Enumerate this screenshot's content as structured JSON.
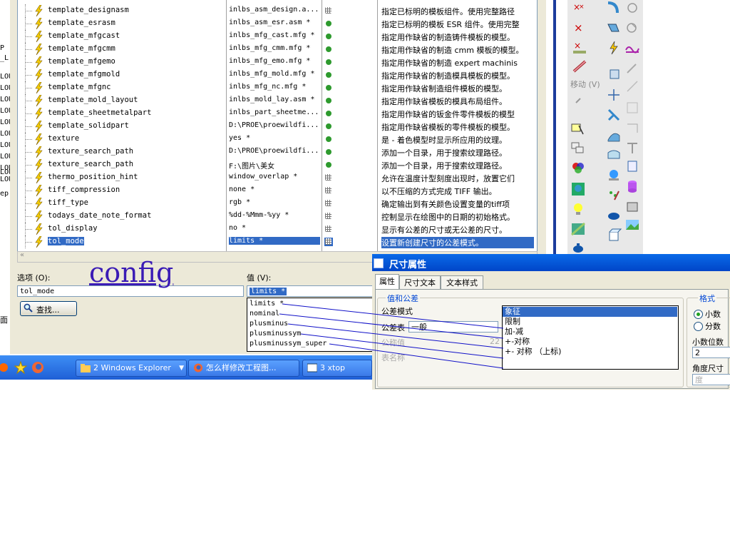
{
  "left_strip": [
    "P",
    "_L",
    "LOU",
    "LOU",
    "LOU",
    "LOU",
    "LOU",
    "LOU",
    "LOU",
    "LOU",
    "LOU",
    "LOU",
    "LOU",
    "ep"
  ],
  "config": {
    "rows": [
      {
        "name": "template_designasm",
        "value": "inlbs_asm_design.a...",
        "status": "grid",
        "desc": "指定已标明的模板组件。使用完整路径"
      },
      {
        "name": "template_esrasm",
        "value": "inlbs_asm_esr.asm *",
        "status": "green",
        "desc": "指定已标明的模板 ESR 组件。使用完整"
      },
      {
        "name": "template_mfgcast",
        "value": "inlbs_mfg_cast.mfg *",
        "status": "green",
        "desc": "指定用作缺省的制造铸件模板的模型。"
      },
      {
        "name": "template_mfgcmm",
        "value": "inlbs_mfg_cmm.mfg *",
        "status": "green",
        "desc": "指定用作缺省的制造 cmm 模板的模型。"
      },
      {
        "name": "template_mfgemo",
        "value": "inlbs_mfg_emo.mfg *",
        "status": "green",
        "desc": "指定用作缺省的制造 expert machinis"
      },
      {
        "name": "template_mfgmold",
        "value": "inlbs_mfg_mold.mfg *",
        "status": "green",
        "desc": "指定用作缺省的制造模具模板的模型。"
      },
      {
        "name": "template_mfgnc",
        "value": "inlbs_mfg_nc.mfg *",
        "status": "green",
        "desc": "指定用作缺省制造组件模板的模型。"
      },
      {
        "name": "template_mold_layout",
        "value": "inlbs_mold_lay.asm *",
        "status": "green",
        "desc": "指定用作缺省模板的模具布局组件。"
      },
      {
        "name": "template_sheetmetalpart",
        "value": "inlbs_part_sheetme...",
        "status": "green",
        "desc": "指定用作缺省的钣金件零件模板的模型"
      },
      {
        "name": "template_solidpart",
        "value": "D:\\PROE\\proewildfi...",
        "status": "green",
        "desc": "指定用作缺省模板的零件模板的模型。"
      },
      {
        "name": "texture",
        "value": "yes *",
        "status": "green",
        "desc": "是 - 着色模型时显示所应用的纹理。"
      },
      {
        "name": "texture_search_path",
        "value": "D:\\PROE\\proewildfi...",
        "status": "green",
        "desc": "添加一个目录，用于搜索纹理路径。"
      },
      {
        "name": "texture_search_path",
        "value": "F:\\图片\\美女",
        "status": "green",
        "desc": "添加一个目录，用于搜索纹理路径。"
      },
      {
        "name": "thermo_position_hint",
        "value": "window_overlap *",
        "status": "grid",
        "desc": "允许在温度计型刻度出现时，放置它们"
      },
      {
        "name": "tiff_compression",
        "value": "none *",
        "status": "grid",
        "desc": "以不压缩的方式完成 TIFF 输出。"
      },
      {
        "name": "tiff_type",
        "value": "rgb *",
        "status": "grid",
        "desc": "确定输出到有关颜色设置变量的tiff项"
      },
      {
        "name": "todays_date_note_format",
        "value": "%dd-%Mmm-%yy *",
        "status": "grid",
        "desc": "控制显示在绘图中的日期的初始格式。"
      },
      {
        "name": "tol_display",
        "value": "no *",
        "status": "grid",
        "desc": "显示有公差的尺寸或无公差的尺寸。"
      },
      {
        "name": "tol_mode",
        "value": "limits *",
        "status": "grid",
        "desc": "设置新创建尺寸的公差模式。",
        "selected": true
      }
    ],
    "option_label": "选项 (O):",
    "option_value": "tol_mode",
    "value_label": "值 (V):",
    "value_value": "limits *",
    "find_button": "查找...",
    "value_options": [
      "limits *",
      "nominal",
      "plusminus",
      "plusminussym",
      "plusminussym_super"
    ],
    "left_cut_label": "面",
    "watermark": "config"
  },
  "toolbar": {
    "move_label": "移动 (V)"
  },
  "taskbar": {
    "tasks": [
      "2 Windows Explorer",
      "怎么样修改工程图...",
      "3 xtop"
    ]
  },
  "dim_dialog": {
    "title": "尺寸属性",
    "tabs": [
      "属性",
      "尺寸文本",
      "文本样式"
    ],
    "group_values_label": "值和公差",
    "tol_mode_label": "公差模式",
    "tol_mode_value": "象征",
    "tol_table_label": "公差表",
    "tol_table_value": "一般",
    "nominal_label": "公称值",
    "nominal_value": "22",
    "table_name_label": "表名称",
    "tol_options": [
      "象征",
      "限制",
      "加-减",
      "+-对称",
      "+- 对称 （上标)"
    ],
    "format_group_label": "格式",
    "radio_decimal": "小数",
    "radio_fraction": "分数",
    "decimal_places_label": "小数位数",
    "decimal_places_value": "2",
    "angle_unit_label": "角度尺寸单",
    "angle_unit_value": "度"
  },
  "colors": {
    "selection": "#316ac5",
    "taskbar": "#245edb",
    "title_bar": "#0a5ae0",
    "annotation_line": "#1010c8"
  }
}
